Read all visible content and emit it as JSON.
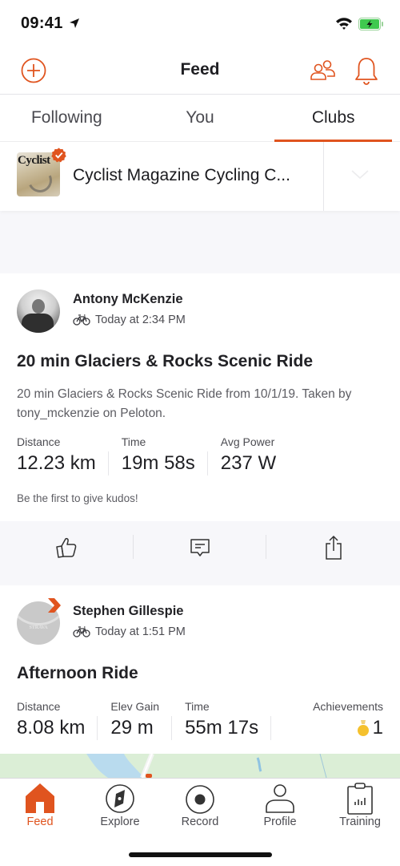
{
  "status_bar": {
    "time": "09:41",
    "location_icon": "location-arrow-icon",
    "wifi_icon": "wifi-icon",
    "battery_icon": "battery-charging-icon"
  },
  "header": {
    "title": "Feed",
    "left_icon": "add-circle-icon",
    "right_icons": [
      "friends-icon",
      "bell-icon"
    ]
  },
  "tabs": [
    {
      "label": "Following",
      "active": false
    },
    {
      "label": "You",
      "active": false
    },
    {
      "label": "Clubs",
      "active": true
    }
  ],
  "club_selector": {
    "logo_text": "Cyclist",
    "name": "Cyclist Magazine Cycling C...",
    "verified": true,
    "dropdown_icon": "chevron-down-icon"
  },
  "activities": [
    {
      "athlete": "Antony McKenzie",
      "activity_icon": "bike-icon",
      "timestamp": "Today at 2:34 PM",
      "title": "20 min Glaciers & Rocks Scenic Ride",
      "description": "20 min Glaciers & Rocks Scenic Ride from 10/1/19. Taken by tony_mckenzie on Peloton.",
      "stats": [
        {
          "label": "Distance",
          "value": "12.23 km"
        },
        {
          "label": "Time",
          "value": "19m 58s"
        },
        {
          "label": "Avg Power",
          "value": "237 W"
        }
      ],
      "kudos_text": "Be the first to give kudos!",
      "actions": [
        "kudos-icon",
        "comment-icon",
        "share-icon"
      ]
    },
    {
      "athlete": "Stephen Gillespie",
      "avatar_text": "STRAVA",
      "activity_icon": "bike-icon",
      "timestamp": "Today at 1:51 PM",
      "title": "Afternoon Ride",
      "stats": [
        {
          "label": "Distance",
          "value": "8.08 km"
        },
        {
          "label": "Elev Gain",
          "value": "29 m"
        },
        {
          "label": "Time",
          "value": "55m 17s"
        }
      ],
      "achievements": {
        "label": "Achievements",
        "value": "1",
        "icon": "medal-icon"
      }
    }
  ],
  "tab_bar": [
    {
      "label": "Feed",
      "icon": "home-icon",
      "active": true
    },
    {
      "label": "Explore",
      "icon": "compass-icon",
      "active": false
    },
    {
      "label": "Record",
      "icon": "record-icon",
      "active": false
    },
    {
      "label": "Profile",
      "icon": "profile-icon",
      "active": false
    },
    {
      "label": "Training",
      "icon": "training-icon",
      "active": false
    }
  ],
  "colors": {
    "accent": "#e0541f",
    "text_primary": "#242428",
    "text_secondary": "#5d5d63",
    "background": "#f7f7fa",
    "medal_gold": "#f5c12e"
  }
}
